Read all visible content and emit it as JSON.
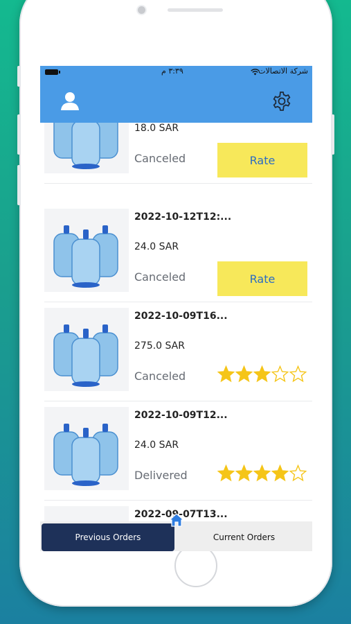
{
  "status_bar": {
    "time": "٣:٣٩ م",
    "carrier": "شركة الاتصالات"
  },
  "navbar": {
    "profile_icon": "user-icon",
    "settings_icon": "gear-icon"
  },
  "orders": [
    {
      "date": "",
      "price": "18.0 SAR",
      "status": "Canceled",
      "action": "Rate",
      "rating": null
    },
    {
      "date": "2022-10-12T12:...",
      "price": "24.0 SAR",
      "status": "Canceled",
      "action": "Rate",
      "rating": null
    },
    {
      "date": "2022-10-09T16...",
      "price": "275.0 SAR",
      "status": "Canceled",
      "action": null,
      "rating": 3
    },
    {
      "date": "2022-10-09T12...",
      "price": "24.0 SAR",
      "status": "Delivered",
      "action": null,
      "rating": 4
    },
    {
      "date": "2022-09-07T13...",
      "price": "",
      "status": "",
      "action": null,
      "rating": null
    }
  ],
  "tabs": {
    "previous": "Previous Orders",
    "current": "Current Orders",
    "active": "previous"
  },
  "colors": {
    "header": "#4a9be6",
    "rate_button": "#f7e85a",
    "active_tab": "#1e3159",
    "star": "#f5c518"
  }
}
